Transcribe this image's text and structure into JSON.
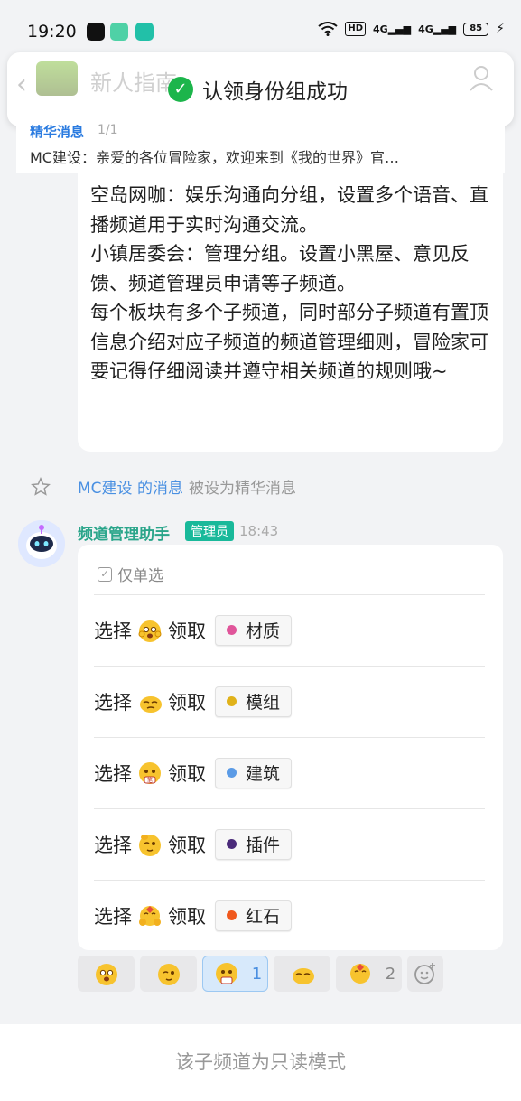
{
  "status_bar": {
    "time": "19:20",
    "network_label": "HD",
    "signal1": "4G",
    "signal2": "4G",
    "battery": "85"
  },
  "header": {
    "channel_name": "新人指南",
    "toast": "认领身份组成功"
  },
  "pinned": {
    "title": "精华消息",
    "count": "1/1",
    "text": "MC建设：亲爱的各位冒险家，欢迎来到《我的世界》官…"
  },
  "message_top": {
    "lines": [
      "空岛网咖：娱乐沟通向分组，设置多个语音、直播频道用于实时沟通交流。",
      "小镇居委会：管理分组。设置小黑屋、意见反馈、频道管理员申请等子频道。",
      "每个板块有多个子频道，同时部分子频道有置顶信息介绍对应子频道的频道管理细则，冒险家可要记得仔细阅读并遵守相关频道的规则哦~"
    ]
  },
  "system_notice": {
    "link": "MC建设 的消息",
    "text": "被设为精华消息"
  },
  "bot_message": {
    "sender": "频道管理助手",
    "badge": "管理员",
    "time": "18:43",
    "hint": "仅单选",
    "select_word": "选择",
    "claim_word": "领取",
    "options": [
      {
        "label": "材质",
        "color": "#e0559a"
      },
      {
        "label": "模组",
        "color": "#e0b21a"
      },
      {
        "label": "建筑",
        "color": "#5b9be6"
      },
      {
        "label": "插件",
        "color": "#4a2b7a"
      },
      {
        "label": "红石",
        "color": "#f0581d"
      }
    ]
  },
  "reactions": [
    {
      "icon": "scared-face-icon",
      "count": ""
    },
    {
      "icon": "salute-face-icon",
      "count": ""
    },
    {
      "icon": "thinking-face-icon",
      "count": "1",
      "active": true
    },
    {
      "icon": "lying-face-icon",
      "count": ""
    },
    {
      "icon": "hug-face-icon",
      "count": "2"
    }
  ],
  "bottom": {
    "readonly_text": "该子频道为只读模式"
  }
}
